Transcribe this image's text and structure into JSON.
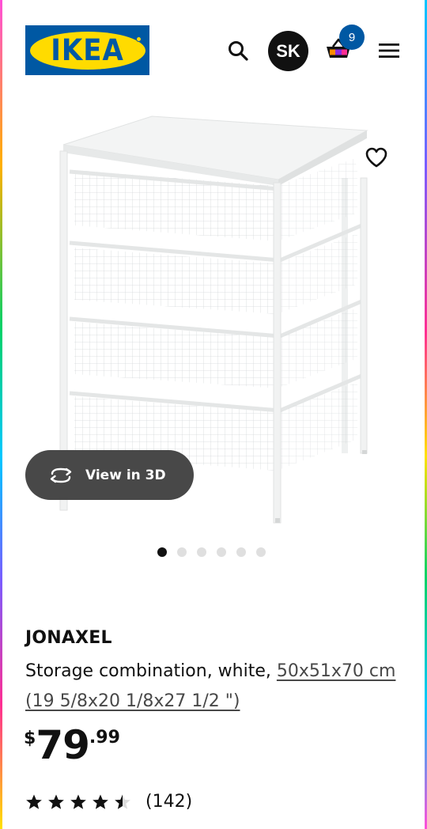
{
  "header": {
    "logo_text": "IKEA",
    "avatar_initials": "SK",
    "cart_count": "9"
  },
  "icons": {
    "search": "search-icon",
    "cart": "shopping-basket-icon",
    "menu": "hamburger-menu-icon",
    "favorite": "heart-icon",
    "rotate": "rotate-3d-icon",
    "rating_star": "star-icon"
  },
  "colors": {
    "ikea_blue": "#0058a3",
    "ikea_yellow": "#ffdb00",
    "view3d_bg": "#484848"
  },
  "gallery": {
    "view3d_label": "View in 3D",
    "image_count": 6,
    "active_index": 0
  },
  "product": {
    "name": "JONAXEL",
    "description": "Storage combination, white, ",
    "measurement": "50x51x70 cm (19 5/8x20 1/8x27 1/2 \")",
    "price_currency": "$",
    "price_integer": "79",
    "price_decimal": ".99",
    "rating": 4.5,
    "rating_max": 5,
    "review_count": "(142)"
  }
}
